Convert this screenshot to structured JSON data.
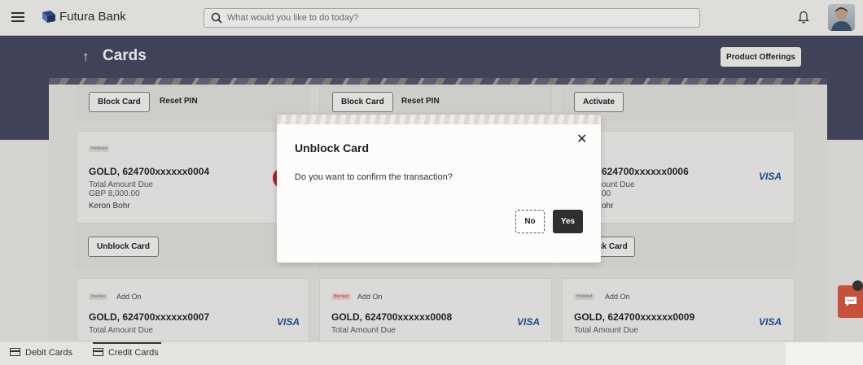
{
  "app": {
    "brand": "Futura Bank",
    "search_placeholder": "What would you like to do today?"
  },
  "page": {
    "title": "Cards",
    "product_offerings_label": "Product Offerings"
  },
  "top_row_actions": {
    "card1": [
      "Block Card",
      "Reset PIN"
    ],
    "card2": [
      "Block Card",
      "Reset PIN"
    ],
    "card3": [
      "Activate"
    ]
  },
  "cards": [
    {
      "status_badge": "Hotlisted",
      "name": "GOLD, 624700xxxxxx0004",
      "due_label": "Total Amount Due",
      "due_value": "GBP 8,000.00",
      "holder": "Keron Bohr",
      "action": "Unblock Card"
    },
    {
      "name": "624700xxxxxx0006",
      "due_label": "ount Due",
      "due_value": "00",
      "holder": "ohr",
      "action": "ck Card",
      "network": "VISA"
    },
    {
      "status_badge": "Inactive",
      "addon": "Add On",
      "name": "GOLD, 624700xxxxxx0007",
      "due_label": "Total Amount Due",
      "network": "VISA"
    },
    {
      "status_badge": "Blocked",
      "addon": "Add On",
      "name": "GOLD, 624700xxxxxx0008",
      "due_label": "Total Amount Due",
      "network": "VISA"
    },
    {
      "status_badge": "Hotlisted",
      "addon": "Add On",
      "name": "GOLD, 624700xxxxxx0009",
      "due_label": "Total Amount Due",
      "network": "VISA"
    }
  ],
  "modal": {
    "title": "Unblock Card",
    "message": "Do you want to confirm the transaction?",
    "no_label": "No",
    "yes_label": "Yes",
    "close_glyph": "✕"
  },
  "bottom_tabs": {
    "debit": "Debit Cards",
    "credit": "Credit Cards"
  },
  "colors": {
    "header_band": "#44475f",
    "visa_blue": "#1a4ea0",
    "chat_orange": "#c8503a",
    "yes_button": "#2f2f2f"
  }
}
